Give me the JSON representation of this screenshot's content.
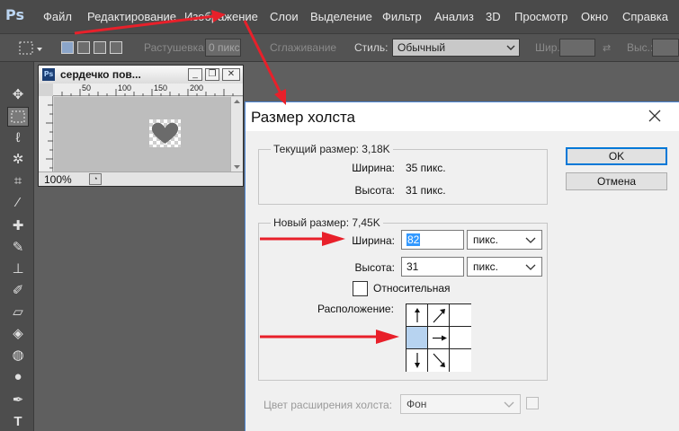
{
  "app": {
    "logo": "Ps",
    "menu": [
      "Файл",
      "Редактирование",
      "Изображение",
      "Слои",
      "Выделение",
      "Фильтр",
      "Анализ",
      "3D",
      "Просмотр",
      "Окно",
      "Справка"
    ]
  },
  "options_bar": {
    "feather_label": "Растушевка:",
    "feather_value": "0 пикс",
    "antialias_label": "Сглаживание",
    "style_label": "Стиль:",
    "style_value": "Обычный",
    "width_label": "Шир.:",
    "height_label": "Выс.:"
  },
  "document": {
    "title": "сердечко пов...",
    "zoom": "100%",
    "ruler": [
      "50",
      "100",
      "150",
      "200"
    ]
  },
  "dialog": {
    "title": "Размер холста",
    "current": {
      "legend": "Текущий размер: 3,18K",
      "width_label": "Ширина:",
      "width_value": "35 пикс.",
      "height_label": "Высота:",
      "height_value": "31 пикс."
    },
    "new": {
      "legend": "Новый размер: 7,45K",
      "width_label": "Ширина:",
      "width_value": "82",
      "width_unit": "пикс.",
      "height_label": "Высота:",
      "height_value": "31",
      "height_unit": "пикс.",
      "relative_label": "Относительная",
      "anchor_label": "Расположение:"
    },
    "extension": {
      "label": "Цвет расширения холста:",
      "value": "Фон"
    },
    "ok_label": "OK",
    "cancel_label": "Отмена"
  },
  "colors": {
    "annotation_arrow": "#e8202a",
    "dialog_border": "#4e87d6",
    "selection": "#3399ff"
  }
}
